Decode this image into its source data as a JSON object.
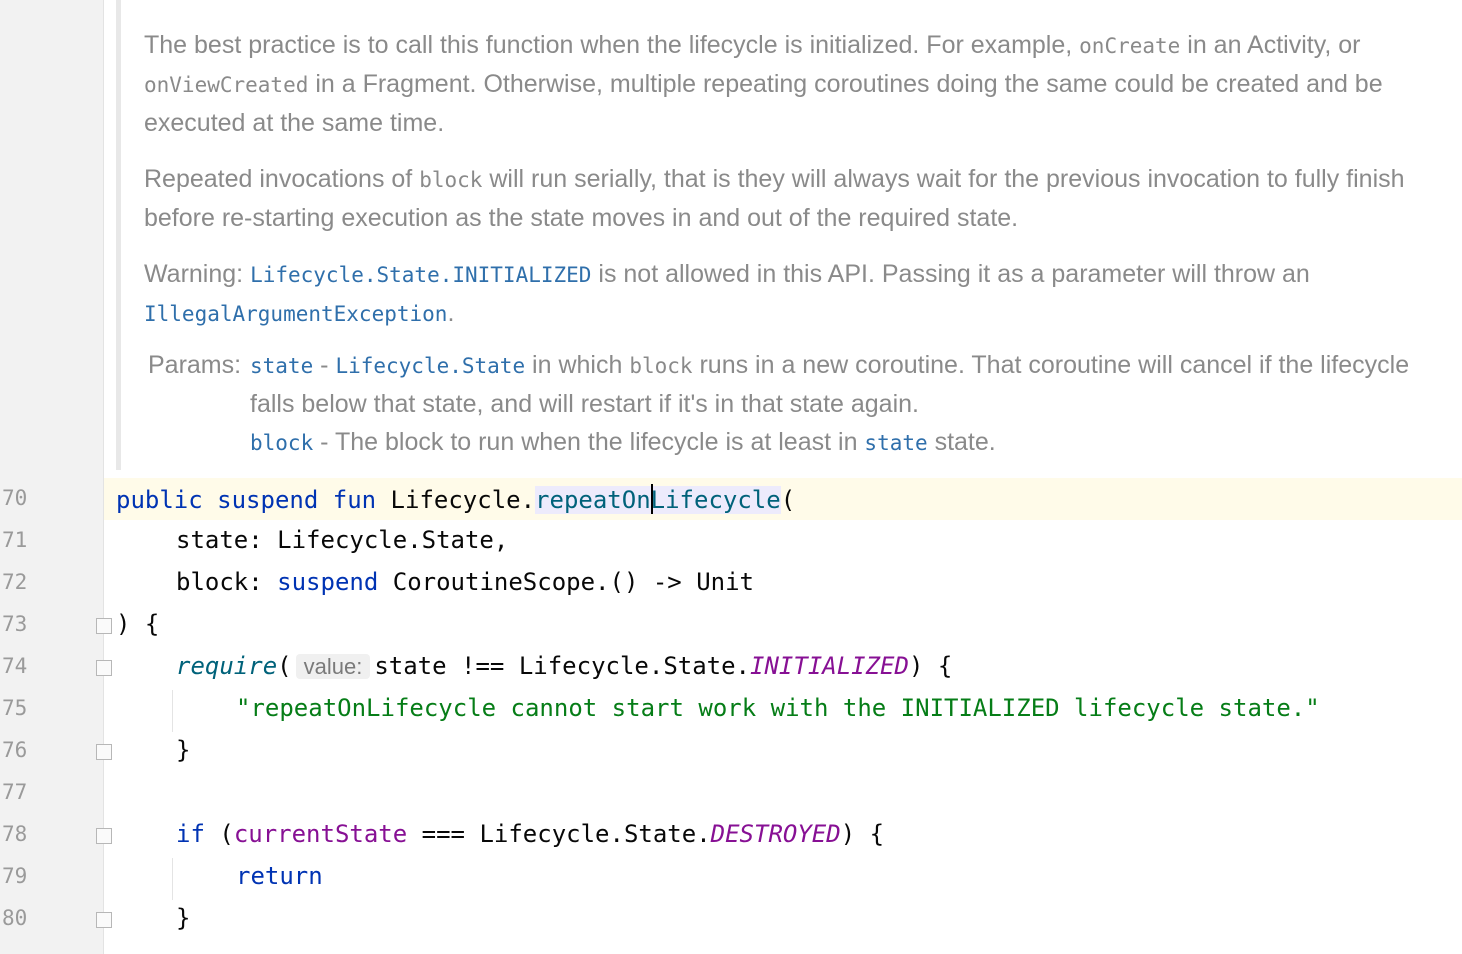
{
  "doc": {
    "p1_a": "The best practice is to call this function when the lifecycle is initialized. For example, ",
    "p1_code1": "onCreate",
    "p1_b": " in an Activity, or ",
    "p1_code2": "onViewCreated",
    "p1_c": " in a Fragment. Otherwise, multiple repeating coroutines doing the same could be created and be executed at the same time.",
    "p2_a": "Repeated invocations of ",
    "p2_code": "block",
    "p2_b": " will run serially, that is they will always wait for the previous invocation to fully finish before re-starting execution as the state moves in and out of the required state.",
    "p3_a": "Warning: ",
    "p3_link1": "Lifecycle.State.INITIALIZED",
    "p3_b": " is not allowed in this API. Passing it as a parameter will throw an ",
    "p3_link2": "IllegalArgumentException",
    "p3_c": ".",
    "params_label": "Params:",
    "param1_name": "state",
    "param1_dash": " - ",
    "param1_link": "Lifecycle.State",
    "param1_a": " in which ",
    "param1_code": "block",
    "param1_b": " runs in a new coroutine. That coroutine will cancel if the lifecycle falls below that state, and will restart if it's in that state again.",
    "param2_name": "block",
    "param2_a": " - The block to run when the lifecycle is at least in ",
    "param2_link": "state",
    "param2_b": " state."
  },
  "line_numbers": [
    "70",
    "71",
    "72",
    "73",
    "74",
    "75",
    "76",
    "77",
    "78",
    "79",
    "80"
  ],
  "code": {
    "l70_kw": "public suspend fun",
    "l70_recv": " Lifecycle.",
    "l70_fn_a": "repeatOn",
    "l70_fn_b": "Lifecycle",
    "l70_paren": "(",
    "l71": "state: Lifecycle.State,",
    "l72_a": "block: ",
    "l72_kw": "suspend",
    "l72_b": " CoroutineScope.() -> Unit",
    "l73": ") {",
    "l74_fn": "require",
    "l74_paren": "(",
    "l74_hint": "value:",
    "l74_a": "state !== Lifecycle.State.",
    "l74_const": "INITIALIZED",
    "l74_b": ") {",
    "l75_str": "\"repeatOnLifecycle cannot start work with the INITIALIZED lifecycle state.\"",
    "l76": "}",
    "l78_kw": "if",
    "l78_a": " (",
    "l78_prop": "currentState",
    "l78_b": " === Lifecycle.State.",
    "l78_const": "DESTROYED",
    "l78_c": ") {",
    "l79_kw": "return",
    "l80": "}"
  }
}
